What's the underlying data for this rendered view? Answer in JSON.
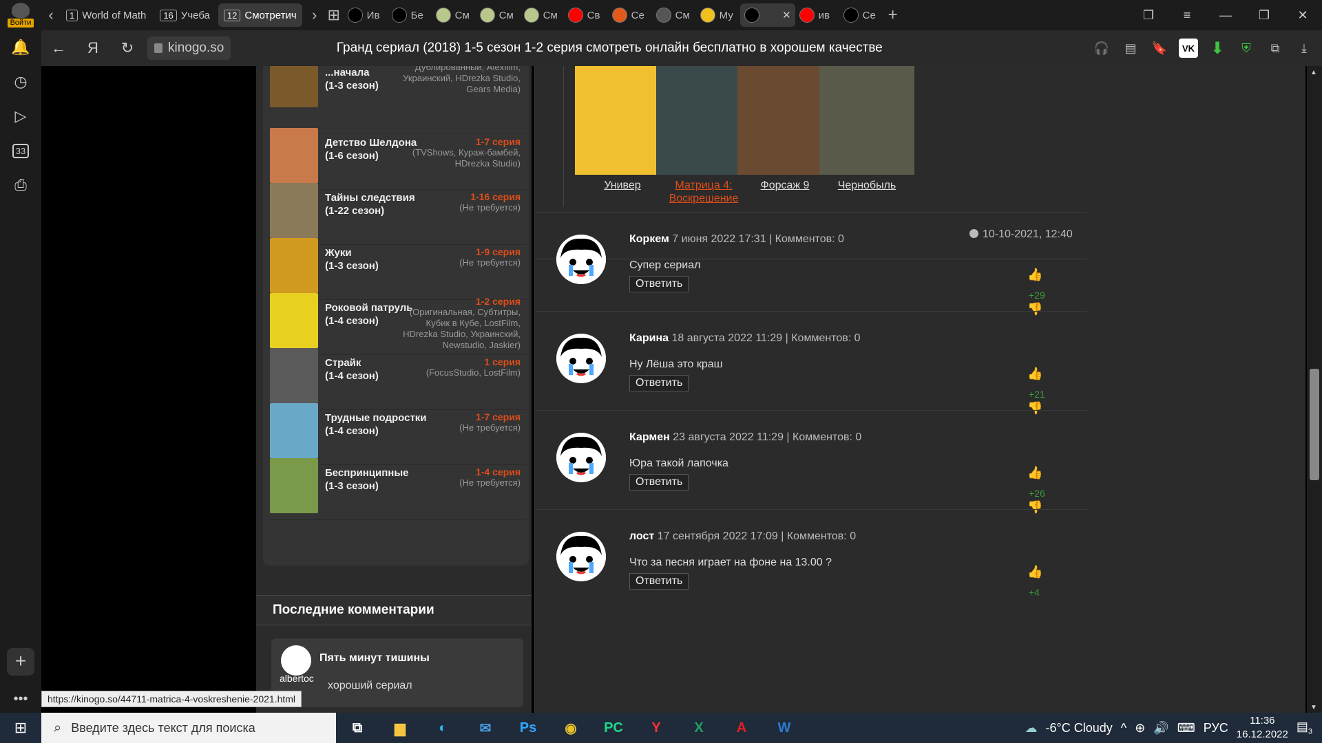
{
  "browser": {
    "profile_label": "Войти",
    "tabs": [
      {
        "num": "1",
        "label": "World of Math"
      },
      {
        "num": "16",
        "label": "Учеба"
      },
      {
        "num": "12",
        "label": "Смотретич"
      }
    ],
    "favicon_tabs": [
      {
        "label": "Ив",
        "color": "#000000"
      },
      {
        "label": "Бе",
        "color": "#000000"
      },
      {
        "label": "См",
        "color": "#b8c88a"
      },
      {
        "label": "См",
        "color": "#b8c88a"
      },
      {
        "label": "См",
        "color": "#b8c88a"
      },
      {
        "label": "Св",
        "color": "#ff0000"
      },
      {
        "label": "Се",
        "color": "#e05a1a"
      },
      {
        "label": "См",
        "color": "#555555"
      },
      {
        "label": "Му",
        "color": "#f0c020"
      },
      {
        "label": "",
        "color": "#000000"
      },
      {
        "label": "ив",
        "color": "#ff0000"
      },
      {
        "label": "Се",
        "color": "#000000"
      }
    ],
    "domain": "kinogo.so",
    "page_title": "Гранд сериал (2018) 1-5 сезон 1-2 серия смотреть онлайн бесплатно в хорошем качестве",
    "sidebar_badge": "33",
    "status_url": "https://kinogo.so/44711-matrica-4-voskreshenie-2021.html"
  },
  "series_list": [
    {
      "name": "...начала\n(1-3 сезон)",
      "episodes": "",
      "voices": "Дублированный, Alexfilm, Украинский, HDrezka Studio, Gears Media)",
      "color": "#7a5a2a"
    },
    {
      "name": "Детство Шелдона\n(1-6 сезон)",
      "episodes": "1-7 серия",
      "voices": "(TVShows, Кураж-бамбей, HDrezka Studio)",
      "color": "#c97a4a"
    },
    {
      "name": "Тайны следствия\n(1-22 сезон)",
      "episodes": "1-16 серия",
      "voices": "(Не требуется)",
      "color": "#8a7a5a"
    },
    {
      "name": "Жуки\n(1-3 сезон)",
      "episodes": "1-9 серия",
      "voices": "(Не требуется)",
      "color": "#d09a20"
    },
    {
      "name": "Роковой патруль\n(1-4 сезон)",
      "episodes": "1-2 серия",
      "voices": "(Оригинальная, Субтитры, Кубик в Кубе, LostFilm, HDrezka Studio, Украинский, Newstudio, Jaskier)",
      "color": "#e8d020"
    },
    {
      "name": "Страйк\n(1-4 сезон)",
      "episodes": "1 серия",
      "voices": "(FocusStudio, LostFilm)",
      "color": "#5a5a5a"
    },
    {
      "name": "Трудные подростки\n(1-4 сезон)",
      "episodes": "1-7 серия",
      "voices": "(Не требуется)",
      "color": "#6aa8c8"
    },
    {
      "name": "Беспринципные\n(1-3 сезон)",
      "episodes": "1-4 серия",
      "voices": "(Не требуется)",
      "color": "#7a9a4a"
    }
  ],
  "last_comments": {
    "heading": "Последние комментарии",
    "item_title": "Пять минут тишины",
    "item_user": "albertoc",
    "item_text": "хороший сериал"
  },
  "related": [
    {
      "title": "Универ",
      "color": "#f0c030",
      "highlight": false
    },
    {
      "title": "Матрица 4: Воскрешение",
      "color": "#3a4a4a",
      "highlight": true
    },
    {
      "title": "Форсаж 9",
      "color": "#6a4a30",
      "highlight": false
    },
    {
      "title": "Чернобыль",
      "color": "#5a5a4a",
      "highlight": false
    }
  ],
  "post_date": "10-10-2021, 12:40",
  "comments": [
    {
      "user": "Коркем",
      "date": "7 июня 2022 17:31",
      "count_label": "| Комментов: 0",
      "text": "Супер сериал",
      "reply": "Ответить",
      "rating": "+29"
    },
    {
      "user": "Карина",
      "date": "18 августа 2022 11:29",
      "count_label": "| Комментов: 0",
      "text": "Ну Лёша это краш",
      "reply": "Ответить",
      "rating": "+21"
    },
    {
      "user": "Кармен",
      "date": "23 августа 2022 11:29",
      "count_label": "| Комментов: 0",
      "text": "Юра такой лапочка",
      "reply": "Ответить",
      "rating": "+26"
    },
    {
      "user": "лост",
      "date": "17 сентября 2022 17:09",
      "count_label": "| Комментов: 0",
      "text": "Что за песня играет на фоне на 13.00 ?",
      "reply": "Ответить",
      "rating": "+4"
    }
  ],
  "taskbar": {
    "search_placeholder": "Введите здесь текст для поиска",
    "weather": "-6°C  Cloudy",
    "lang": "РУС",
    "time": "11:36",
    "date": "16.12.2022",
    "notifications": "3",
    "apps": [
      {
        "icon": "task-view-icon",
        "glyph": "⧉",
        "color": "#ffffff"
      },
      {
        "icon": "explorer-icon",
        "glyph": "▆",
        "color": "#f5c542"
      },
      {
        "icon": "edge-icon",
        "glyph": "◐",
        "color": "#2fb5e8"
      },
      {
        "icon": "mail-icon",
        "glyph": "✉",
        "color": "#4aa0e8"
      },
      {
        "icon": "photoshop-icon",
        "glyph": "Ps",
        "color": "#31a8ff"
      },
      {
        "icon": "chrome-icon",
        "glyph": "◉",
        "color": "#e8c02a"
      },
      {
        "icon": "pycharm-icon",
        "glyph": "PC",
        "color": "#21d789"
      },
      {
        "icon": "yandex-icon",
        "glyph": "Y",
        "color": "#ff3333"
      },
      {
        "icon": "excel-icon",
        "glyph": "X",
        "color": "#21a366"
      },
      {
        "icon": "acrobat-icon",
        "glyph": "A",
        "color": "#e02020"
      },
      {
        "icon": "word-icon",
        "glyph": "W",
        "color": "#2b7cd3"
      }
    ]
  }
}
